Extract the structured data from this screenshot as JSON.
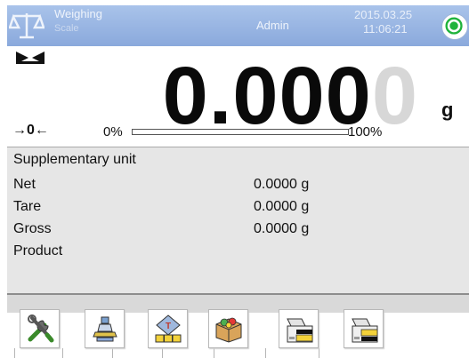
{
  "header": {
    "mode_name": "Weighing",
    "mode_sub": "Scale",
    "user": "Admin",
    "date": "2015.03.25",
    "time": "11:06:21",
    "logo_icon": "scale-logo-icon",
    "level_icon": "level-indicator-icon",
    "level_color": "#1fb33b"
  },
  "display": {
    "weight_main": "0.000",
    "weight_last": "0",
    "unit": "g",
    "zero_marker": "→0←",
    "bar_min": "0%",
    "bar_max": "100%",
    "bar_fill": 0,
    "stable_icon": "stable-marker-icon"
  },
  "info": {
    "title": "Supplementary unit",
    "rows": [
      {
        "label": "Net",
        "value": "0.0000 g"
      },
      {
        "label": "Tare",
        "value": "0.0000 g"
      },
      {
        "label": "Gross",
        "value": "0.0000 g"
      },
      {
        "label": "Product",
        "value": ""
      }
    ]
  },
  "toolbar": {
    "buttons": [
      {
        "name": "settings-button",
        "icon": "tools-icon"
      },
      {
        "name": "tare-button",
        "icon": "scale-tare-icon"
      },
      {
        "name": "tare-database-button",
        "icon": "tare-keypad-icon"
      },
      {
        "name": "product-button",
        "icon": "product-box-icon"
      },
      {
        "name": "print-header-button",
        "icon": "printer-icon"
      },
      {
        "name": "print-footer-button",
        "icon": "printer-icon"
      }
    ]
  },
  "colors": {
    "header_bg": "#8aa9dc",
    "info_bg": "#e6e6e6",
    "digit_ghost": "#d7d7d7"
  }
}
